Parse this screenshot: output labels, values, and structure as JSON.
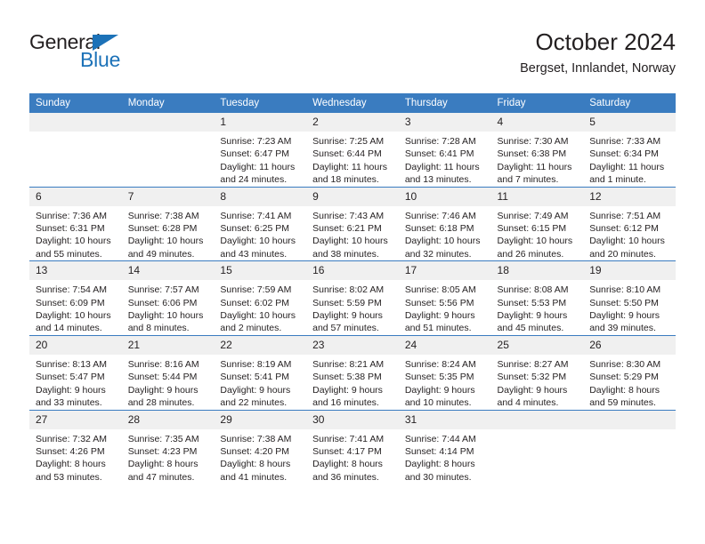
{
  "branding": {
    "name_dark": "General",
    "name_blue": "Blue",
    "accent_color": "#1c72b8"
  },
  "header": {
    "title": "October 2024",
    "subtitle": "Bergset, Innlandet, Norway"
  },
  "colors": {
    "header_row": "#3a7cc0",
    "daynum_band": "#f0f0f0",
    "text": "#231f20"
  },
  "weekday_headers": [
    "Sunday",
    "Monday",
    "Tuesday",
    "Wednesday",
    "Thursday",
    "Friday",
    "Saturday"
  ],
  "weeks": [
    [
      {
        "day": "",
        "sunrise": "",
        "sunset": "",
        "daylight": ""
      },
      {
        "day": "",
        "sunrise": "",
        "sunset": "",
        "daylight": ""
      },
      {
        "day": "1",
        "sunrise": "Sunrise: 7:23 AM",
        "sunset": "Sunset: 6:47 PM",
        "daylight": "Daylight: 11 hours and 24 minutes."
      },
      {
        "day": "2",
        "sunrise": "Sunrise: 7:25 AM",
        "sunset": "Sunset: 6:44 PM",
        "daylight": "Daylight: 11 hours and 18 minutes."
      },
      {
        "day": "3",
        "sunrise": "Sunrise: 7:28 AM",
        "sunset": "Sunset: 6:41 PM",
        "daylight": "Daylight: 11 hours and 13 minutes."
      },
      {
        "day": "4",
        "sunrise": "Sunrise: 7:30 AM",
        "sunset": "Sunset: 6:38 PM",
        "daylight": "Daylight: 11 hours and 7 minutes."
      },
      {
        "day": "5",
        "sunrise": "Sunrise: 7:33 AM",
        "sunset": "Sunset: 6:34 PM",
        "daylight": "Daylight: 11 hours and 1 minute."
      }
    ],
    [
      {
        "day": "6",
        "sunrise": "Sunrise: 7:36 AM",
        "sunset": "Sunset: 6:31 PM",
        "daylight": "Daylight: 10 hours and 55 minutes."
      },
      {
        "day": "7",
        "sunrise": "Sunrise: 7:38 AM",
        "sunset": "Sunset: 6:28 PM",
        "daylight": "Daylight: 10 hours and 49 minutes."
      },
      {
        "day": "8",
        "sunrise": "Sunrise: 7:41 AM",
        "sunset": "Sunset: 6:25 PM",
        "daylight": "Daylight: 10 hours and 43 minutes."
      },
      {
        "day": "9",
        "sunrise": "Sunrise: 7:43 AM",
        "sunset": "Sunset: 6:21 PM",
        "daylight": "Daylight: 10 hours and 38 minutes."
      },
      {
        "day": "10",
        "sunrise": "Sunrise: 7:46 AM",
        "sunset": "Sunset: 6:18 PM",
        "daylight": "Daylight: 10 hours and 32 minutes."
      },
      {
        "day": "11",
        "sunrise": "Sunrise: 7:49 AM",
        "sunset": "Sunset: 6:15 PM",
        "daylight": "Daylight: 10 hours and 26 minutes."
      },
      {
        "day": "12",
        "sunrise": "Sunrise: 7:51 AM",
        "sunset": "Sunset: 6:12 PM",
        "daylight": "Daylight: 10 hours and 20 minutes."
      }
    ],
    [
      {
        "day": "13",
        "sunrise": "Sunrise: 7:54 AM",
        "sunset": "Sunset: 6:09 PM",
        "daylight": "Daylight: 10 hours and 14 minutes."
      },
      {
        "day": "14",
        "sunrise": "Sunrise: 7:57 AM",
        "sunset": "Sunset: 6:06 PM",
        "daylight": "Daylight: 10 hours and 8 minutes."
      },
      {
        "day": "15",
        "sunrise": "Sunrise: 7:59 AM",
        "sunset": "Sunset: 6:02 PM",
        "daylight": "Daylight: 10 hours and 2 minutes."
      },
      {
        "day": "16",
        "sunrise": "Sunrise: 8:02 AM",
        "sunset": "Sunset: 5:59 PM",
        "daylight": "Daylight: 9 hours and 57 minutes."
      },
      {
        "day": "17",
        "sunrise": "Sunrise: 8:05 AM",
        "sunset": "Sunset: 5:56 PM",
        "daylight": "Daylight: 9 hours and 51 minutes."
      },
      {
        "day": "18",
        "sunrise": "Sunrise: 8:08 AM",
        "sunset": "Sunset: 5:53 PM",
        "daylight": "Daylight: 9 hours and 45 minutes."
      },
      {
        "day": "19",
        "sunrise": "Sunrise: 8:10 AM",
        "sunset": "Sunset: 5:50 PM",
        "daylight": "Daylight: 9 hours and 39 minutes."
      }
    ],
    [
      {
        "day": "20",
        "sunrise": "Sunrise: 8:13 AM",
        "sunset": "Sunset: 5:47 PM",
        "daylight": "Daylight: 9 hours and 33 minutes."
      },
      {
        "day": "21",
        "sunrise": "Sunrise: 8:16 AM",
        "sunset": "Sunset: 5:44 PM",
        "daylight": "Daylight: 9 hours and 28 minutes."
      },
      {
        "day": "22",
        "sunrise": "Sunrise: 8:19 AM",
        "sunset": "Sunset: 5:41 PM",
        "daylight": "Daylight: 9 hours and 22 minutes."
      },
      {
        "day": "23",
        "sunrise": "Sunrise: 8:21 AM",
        "sunset": "Sunset: 5:38 PM",
        "daylight": "Daylight: 9 hours and 16 minutes."
      },
      {
        "day": "24",
        "sunrise": "Sunrise: 8:24 AM",
        "sunset": "Sunset: 5:35 PM",
        "daylight": "Daylight: 9 hours and 10 minutes."
      },
      {
        "day": "25",
        "sunrise": "Sunrise: 8:27 AM",
        "sunset": "Sunset: 5:32 PM",
        "daylight": "Daylight: 9 hours and 4 minutes."
      },
      {
        "day": "26",
        "sunrise": "Sunrise: 8:30 AM",
        "sunset": "Sunset: 5:29 PM",
        "daylight": "Daylight: 8 hours and 59 minutes."
      }
    ],
    [
      {
        "day": "27",
        "sunrise": "Sunrise: 7:32 AM",
        "sunset": "Sunset: 4:26 PM",
        "daylight": "Daylight: 8 hours and 53 minutes."
      },
      {
        "day": "28",
        "sunrise": "Sunrise: 7:35 AM",
        "sunset": "Sunset: 4:23 PM",
        "daylight": "Daylight: 8 hours and 47 minutes."
      },
      {
        "day": "29",
        "sunrise": "Sunrise: 7:38 AM",
        "sunset": "Sunset: 4:20 PM",
        "daylight": "Daylight: 8 hours and 41 minutes."
      },
      {
        "day": "30",
        "sunrise": "Sunrise: 7:41 AM",
        "sunset": "Sunset: 4:17 PM",
        "daylight": "Daylight: 8 hours and 36 minutes."
      },
      {
        "day": "31",
        "sunrise": "Sunrise: 7:44 AM",
        "sunset": "Sunset: 4:14 PM",
        "daylight": "Daylight: 8 hours and 30 minutes."
      },
      {
        "day": "",
        "sunrise": "",
        "sunset": "",
        "daylight": ""
      },
      {
        "day": "",
        "sunrise": "",
        "sunset": "",
        "daylight": ""
      }
    ]
  ]
}
